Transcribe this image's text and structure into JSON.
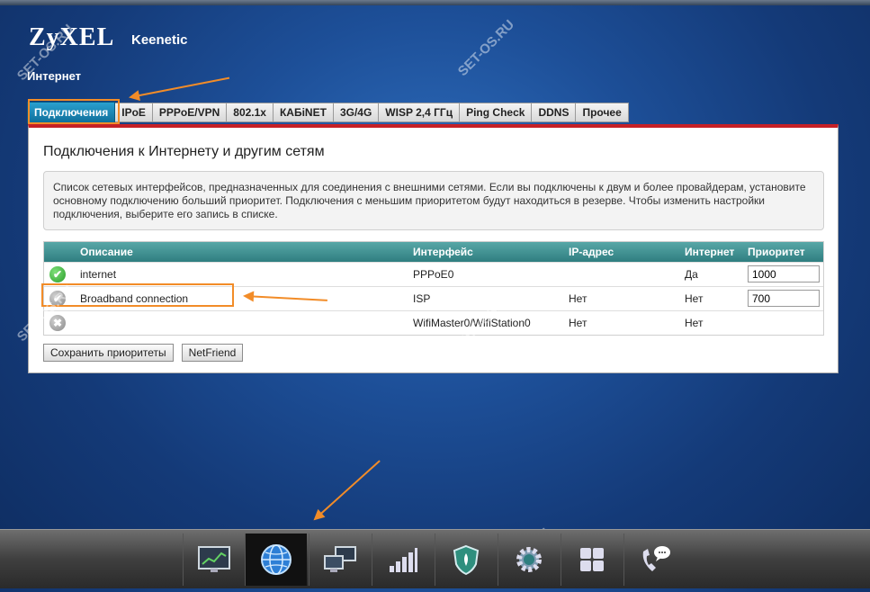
{
  "header": {
    "logo": "ZyXEL",
    "model": "Keenetic",
    "section": "Интернет"
  },
  "tabs": [
    {
      "label": "Подключения",
      "active": true
    },
    {
      "label": "IPoE"
    },
    {
      "label": "PPPoE/VPN"
    },
    {
      "label": "802.1x"
    },
    {
      "label": "КАБiNET"
    },
    {
      "label": "3G/4G"
    },
    {
      "label": "WISP 2,4 ГГц"
    },
    {
      "label": "Ping Check"
    },
    {
      "label": "DDNS"
    },
    {
      "label": "Прочее"
    }
  ],
  "panel": {
    "title": "Подключения к Интернету и другим сетям",
    "info": "Список сетевых интерфейсов, предназначенных для соединения с внешними сетями. Если вы подключены к двум и более провайдерам, установите основному подключению больший приоритет. Подключения с меньшим приоритетом будут находиться в резерве. Чтобы изменить настройки подключения, выберите его запись в списке."
  },
  "table": {
    "headers": {
      "description": "Описание",
      "interface": "Интерфейс",
      "ip": "IP-адрес",
      "internet": "Интернет",
      "priority": "Приоритет"
    },
    "rows": [
      {
        "status": "ok",
        "description": "internet",
        "interface": "PPPoE0",
        "ip": "",
        "internet": "Да",
        "priority": "1000"
      },
      {
        "status": "disabled",
        "description": "Broadband connection",
        "interface": "ISP",
        "ip": "Нет",
        "internet": "Нет",
        "priority": "700"
      },
      {
        "status": "off",
        "description": "",
        "interface": "WifiMaster0/WifiStation0",
        "ip": "Нет",
        "internet": "Нет",
        "priority": ""
      }
    ]
  },
  "buttons": {
    "save_priorities": "Сохранить приоритеты",
    "netfriend": "NetFriend"
  },
  "watermark": "SET-OS.RU",
  "taskbar": [
    {
      "icon": "monitor-chart-icon"
    },
    {
      "icon": "globe-icon",
      "selected": true
    },
    {
      "icon": "network-computers-icon"
    },
    {
      "icon": "signal-bars-icon"
    },
    {
      "icon": "shield-icon"
    },
    {
      "icon": "gear-icon"
    },
    {
      "icon": "apps-grid-icon"
    },
    {
      "icon": "phone-chat-icon"
    }
  ],
  "colors": {
    "accent_orange": "#f28c28",
    "active_tab": "#0f6f9b",
    "table_header": "#2f7e80",
    "panel_top_border": "#c62026"
  }
}
